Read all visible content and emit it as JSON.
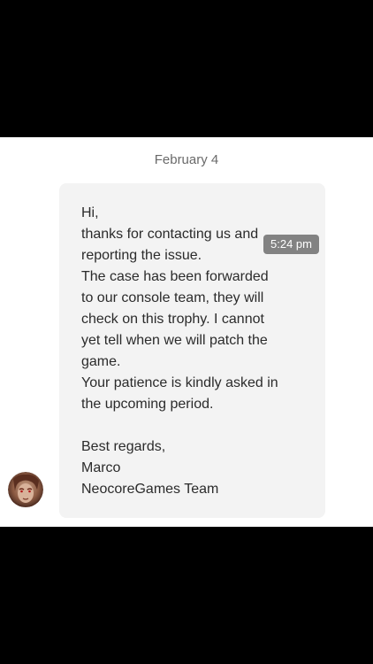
{
  "conversation": {
    "date_separator": "February 4"
  },
  "message": {
    "lines": [
      "Hi,",
      "thanks for contacting us and",
      "reporting the issue.",
      "The case has been forwarded",
      "to our console team, they will",
      "check on this trophy. I cannot",
      "yet tell when we will patch the",
      "game.",
      "Your patience is kindly asked in",
      "the upcoming period.",
      "",
      "Best regards,",
      "Marco",
      "NeocoreGames Team"
    ],
    "time": "5:24 pm"
  },
  "sender": {
    "avatar_icon": "avatar-icon"
  },
  "colors": {
    "bubble_bg": "#f3f3f3",
    "time_badge_bg": "#828282",
    "text": "#2b2b2b"
  }
}
